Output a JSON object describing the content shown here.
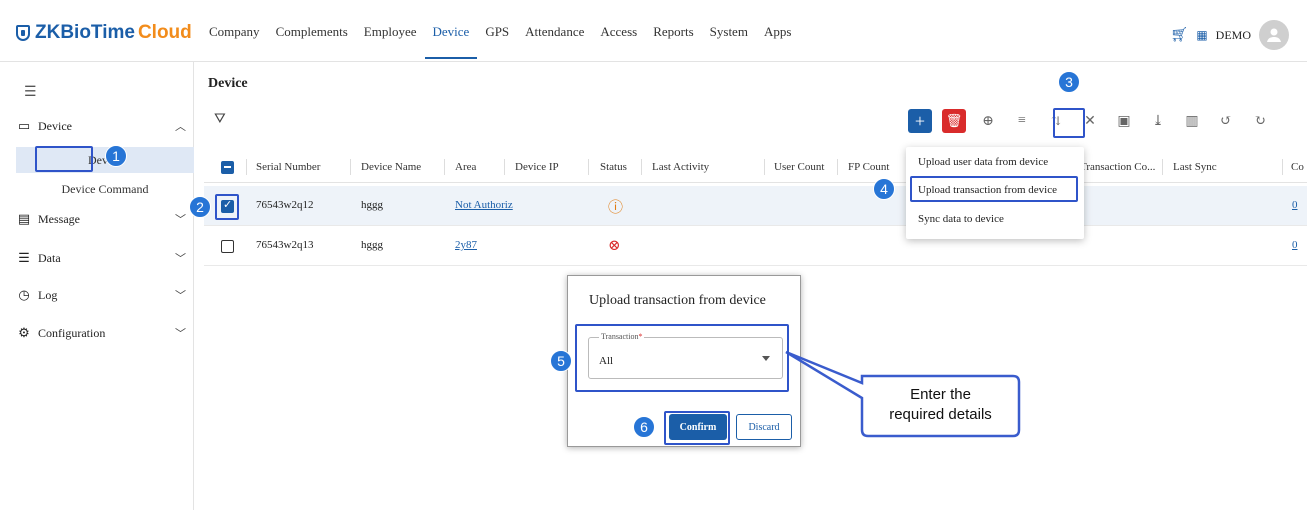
{
  "brand": {
    "logo_main": "ZKBioTime",
    "logo_accent": "Cloud"
  },
  "nav": [
    "Company",
    "Complements",
    "Employee",
    "Device",
    "GPS",
    "Attendance",
    "Access",
    "Reports",
    "System",
    "Apps"
  ],
  "user": {
    "name": "DEMO"
  },
  "sidebar": {
    "device_group": "Device",
    "sub_device": "Device",
    "sub_command": "Device Command",
    "message": "Message",
    "data": "Data",
    "log": "Log",
    "configuration": "Configuration"
  },
  "page": {
    "title": "Device"
  },
  "table": {
    "columns": [
      "Serial Number",
      "Device Name",
      "Area",
      "Device IP",
      "Status",
      "Last Activity",
      "User Count",
      "FP Count",
      "Transaction Co...",
      "Last Sync",
      "Co"
    ],
    "rows": [
      {
        "serial": "76543w2q12",
        "name": "hggg",
        "area": "Not Authoriz",
        "status": "warning",
        "count_link": "0"
      },
      {
        "serial": "76543w2q13",
        "name": "hggg",
        "area": "2y87",
        "status": "error",
        "count_link": "0"
      }
    ]
  },
  "dropdown": {
    "items": [
      "Upload user data from device",
      "Upload transaction from device",
      "Sync data to device"
    ]
  },
  "modal": {
    "title": "Upload transaction from device",
    "field_label": "Transaction",
    "field_required": "*",
    "field_value": "All",
    "confirm": "Confirm",
    "discard": "Discard"
  },
  "annotations": {
    "steps": [
      "1",
      "2",
      "3",
      "4",
      "5",
      "6"
    ],
    "callout_line1": "Enter the",
    "callout_line2": "required details"
  },
  "colors": {
    "brand_blue": "#1b5ea8",
    "accent_orange": "#f28c1b",
    "delete_red": "#d92b2b",
    "annotation_blue": "#2775d6"
  }
}
